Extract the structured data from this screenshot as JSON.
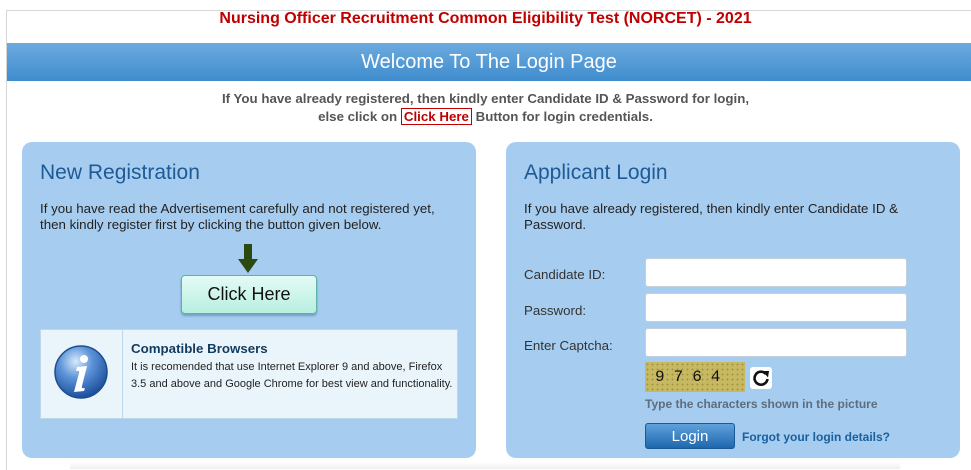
{
  "header": {
    "title": "Nursing Officer Recruitment Common Eligibility Test (NORCET) - 2021",
    "bar_text": "Welcome To The Login Page"
  },
  "intro": {
    "line1": "If You have already registered, then kindly enter Candidate ID & Password for login,",
    "line2_before": "else click on ",
    "link": "Click Here",
    "line2_after": " Button for login credentials."
  },
  "registration": {
    "heading": "New Registration",
    "text": "If you have read the Advertisement carefully and not registered yet, then kindly register first by clicking the button given below.",
    "button": "Click Here",
    "compat_title": "Compatible Browsers",
    "compat_text": "It is recomended that use Internet Explorer 9 and above, Firefox 3.5 and above and Google Chrome for best view and functionality.",
    "info_icon": "info-icon"
  },
  "login": {
    "heading": "Applicant Login",
    "text": "If you have already registered, then kindly enter Candidate ID & Password.",
    "candidate_label": "Candidate ID:",
    "candidate_value": "",
    "password_label": "Password:",
    "password_value": "",
    "captcha_label": "Enter Captcha:",
    "captcha_value": "",
    "captcha_code": "9764",
    "captcha_hint": "Type the characters shown in the picture",
    "login_button": "Login",
    "forgot_link": "Forgot your login details?"
  },
  "colors": {
    "accent": "#3f8ccd",
    "title_red": "#c00000",
    "panel": "#a6cdf0"
  }
}
